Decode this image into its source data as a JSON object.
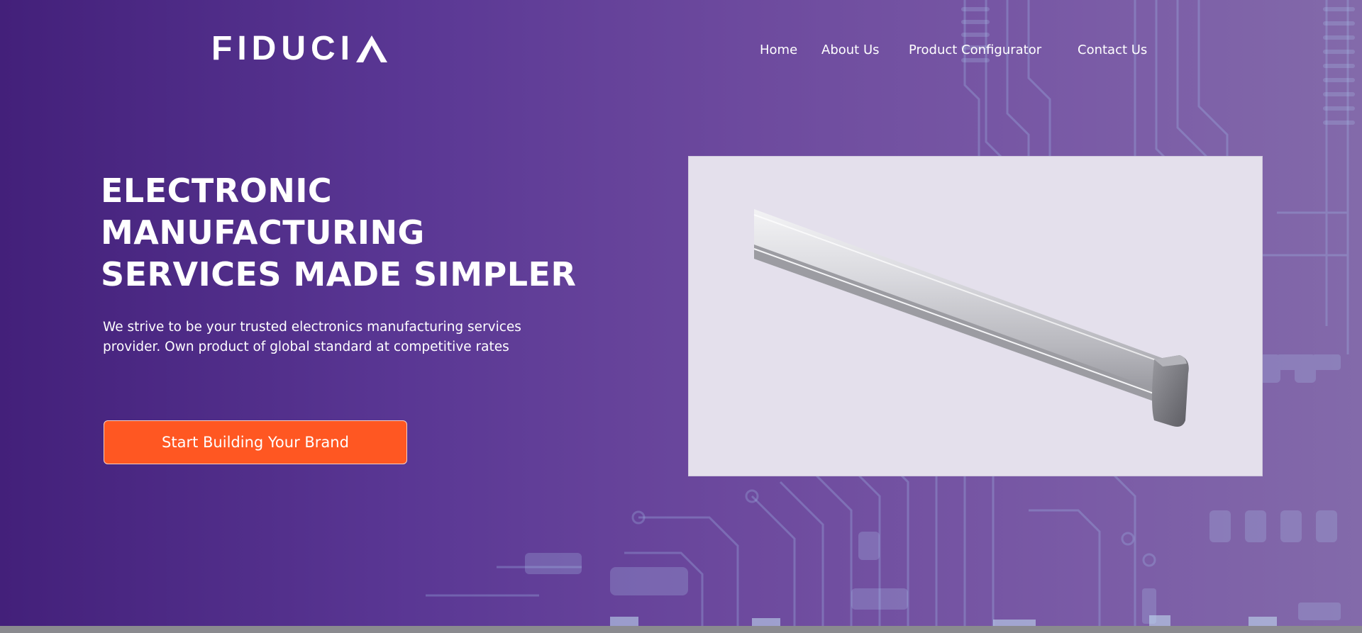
{
  "brand": {
    "name": "FIDUCIA",
    "text_letters": "FIDUCI"
  },
  "nav": {
    "items": [
      {
        "label": "Home"
      },
      {
        "label": "About Us"
      },
      {
        "label": "Product Configurator"
      },
      {
        "label": "Contact Us"
      }
    ]
  },
  "hero": {
    "headline_lines": [
      "ELECTRONIC",
      "MANUFACTURING",
      "SERVICES MADE SIMPLER"
    ],
    "subtext_lines": [
      "We strive to be your trusted electronics manufacturing services",
      "provider. Own product of global standard at competitive rates"
    ],
    "cta_label": "Start Building Your Brand",
    "product_image": "led-tube-light"
  },
  "colors": {
    "cta": "#ff5722",
    "background_start": "#43207a",
    "background_end": "#836aaa",
    "text": "#ffffff"
  }
}
